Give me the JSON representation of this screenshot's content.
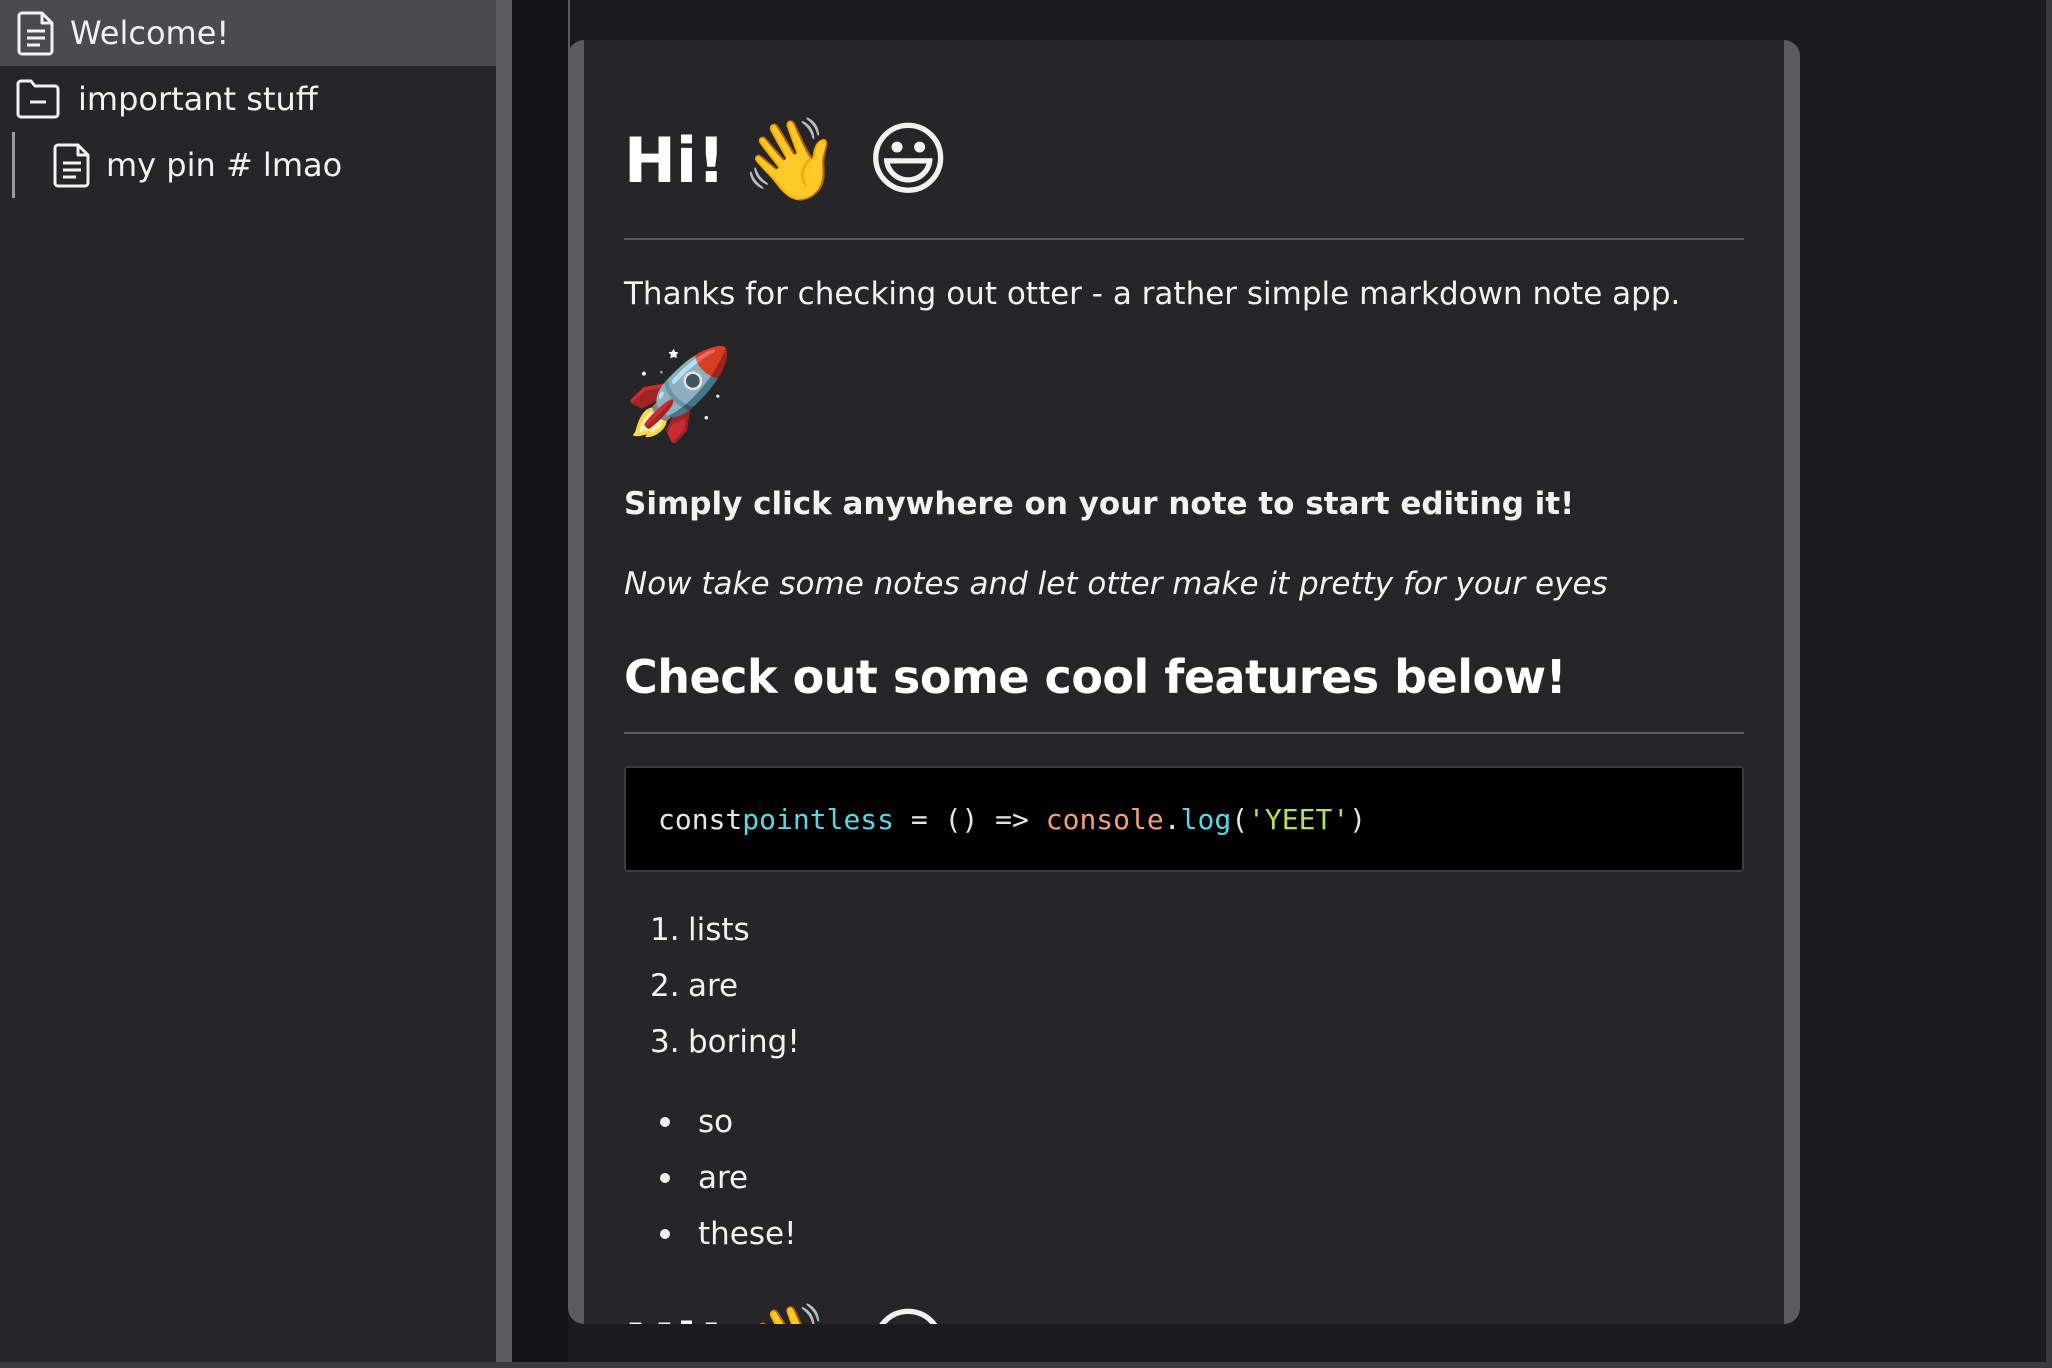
{
  "sidebar": {
    "items": [
      {
        "label": "Welcome!",
        "icon": "file-icon",
        "active": true
      },
      {
        "label": "important stuff",
        "icon": "folder-open-icon",
        "active": false
      },
      {
        "label": "my pin # lmao",
        "icon": "file-icon",
        "active": false
      }
    ]
  },
  "note": {
    "title": "Hi!",
    "title_emojis": "👋 😃",
    "intro": "Thanks for checking out otter - a rather simple markdown note app.",
    "rocket": "🚀",
    "bold_line": "Simply click anywhere on your note to start editing it!",
    "italic_line": "Now take some notes and let otter make it pretty for your eyes",
    "features_heading": "Check out some cool features below!",
    "code": {
      "kw": "const",
      "fn": "pointless",
      "op": " = () => ",
      "obj": "console",
      "dot": ".",
      "method": "log",
      "paren_open": "(",
      "str": "'YEET'",
      "paren_close": ")"
    },
    "ordered_list": [
      "lists",
      "are",
      "boring!"
    ],
    "bullet_list": [
      "so",
      "are",
      "these!"
    ],
    "repeat_title": "Hi!",
    "repeat_emojis": "👋 😃"
  },
  "colors": {
    "background": "#1c1c1e",
    "sidebar": "#262628",
    "active_row": "#4a4a4f",
    "code_bg": "#000000",
    "code_fn": "#5cd6e6",
    "code_obj": "#f0a07a",
    "code_str": "#b6e05a"
  }
}
